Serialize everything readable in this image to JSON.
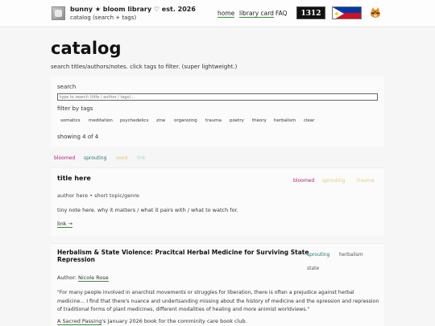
{
  "header": {
    "title": "bunny ★ bloom library ♡ est. 2026",
    "subtitle": "catalog (search + tags)",
    "nav": [
      "home",
      "library card",
      "FAQ"
    ],
    "badge_text": "1312"
  },
  "page": {
    "title": "catalog",
    "description": "search titles/authors/notes. click tags to filter. (super lightweight.)"
  },
  "search": {
    "label": "search",
    "placeholder": "type to search (title / author / tags)...",
    "value": "",
    "tags_label": "filter by tags",
    "tags": [
      "somatics",
      "meditation",
      "psychedelics",
      "zine",
      "organizing",
      "trauma",
      "poetry",
      "theory",
      "herbalism",
      "clear"
    ],
    "count_text": "showing 4 of 4"
  },
  "status_filters": [
    {
      "label": "bloomed",
      "color": "#b0207a"
    },
    {
      "label": "sprouting",
      "color": "#1f7a72"
    },
    {
      "label": "seed",
      "color": "#e8c77a"
    },
    {
      "label": "link",
      "color": "#a8d8c0"
    }
  ],
  "cards": [
    {
      "title": "title here",
      "badges": [
        {
          "label": "bloomed",
          "color": "#b0207a"
        },
        {
          "label": "sprouting",
          "color": "#e8c77a"
        },
        {
          "label": "trauma",
          "color": "#e8c77a"
        }
      ],
      "meta": "author here • short topic/genre",
      "note": "tiny note here. why it matters / what it pairs with / what to watch for.",
      "link": "link →"
    },
    {
      "title_line1": "Herbalism & State Violence: Pracitcal Herbal Medicine for Surviving State",
      "title_line2": "Repression",
      "badges": [
        {
          "label": "sprouting",
          "color": "#1f7a72"
        },
        {
          "label": "herbalism",
          "color": "#555555"
        },
        {
          "label": "state",
          "color": "#555555"
        }
      ],
      "author_prefix": "Author:",
      "author": "Nicole Rose",
      "quote": "\"For many people involved in anarchist movements or struggles for liberation, there is often a prejudice against herbal medicine... I find that there's nuance and undertsanding missing about the history of medicine and the opression and repression of traditional forms of plant medicines, different modalities of healing and more animist worldviews.\"",
      "footer_link": "A Sacred Passing",
      "footer_rest": "'s January 2026 book for the comminity care book club."
    }
  ]
}
